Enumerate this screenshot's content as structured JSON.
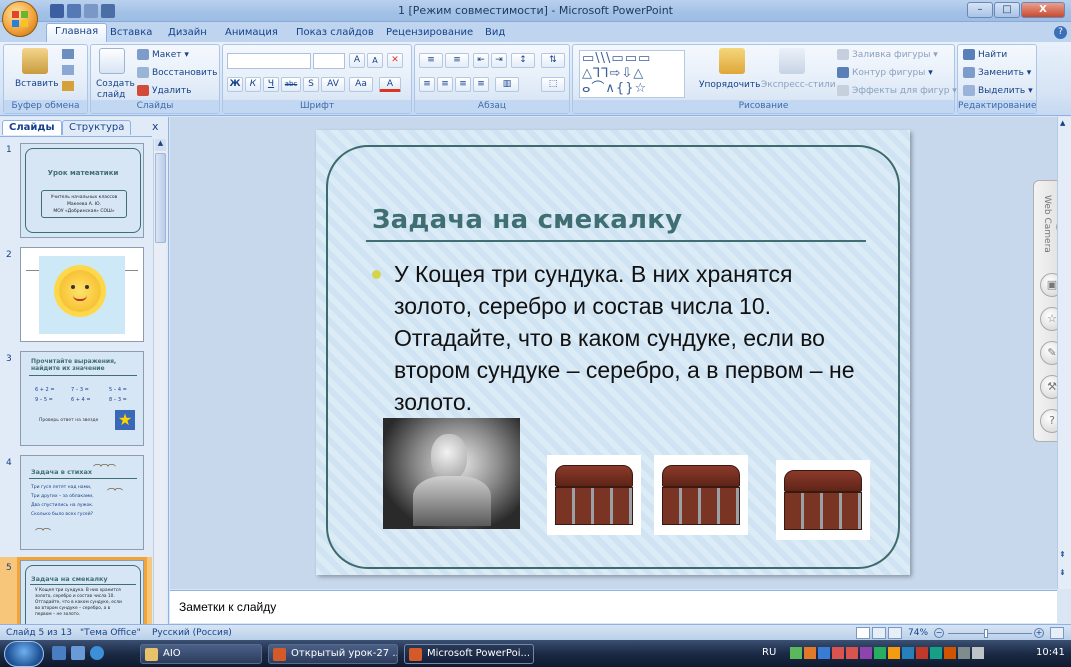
{
  "window": {
    "title": "1 [Режим совместимости] - Microsoft PowerPoint",
    "controls": [
      "–",
      "□",
      "X"
    ]
  },
  "ribbon_tabs": [
    "Главная",
    "Вставка",
    "Дизайн",
    "Анимация",
    "Показ слайдов",
    "Рецензирование",
    "Вид"
  ],
  "ribbon": {
    "clipboard": {
      "paste": "Вставить",
      "label": "Буфер обмена"
    },
    "slides": {
      "create": "Создать",
      "create2": "слайд",
      "layout": "Макет",
      "restore": "Восстановить",
      "delete": "Удалить",
      "label": "Слайды"
    },
    "font": {
      "label": "Шрифт",
      "grow": "A",
      "shrink": "A",
      "bold": "Ж",
      "italic": "К",
      "underline": "Ч",
      "strike": "abc",
      "shadow": "S",
      "spacing": "AV",
      "case": "Aa",
      "color": "A"
    },
    "paragraph": {
      "label": "Абзац"
    },
    "drawing": {
      "arrange": "Упорядочить",
      "styles": "Экспресс-стили",
      "fill": "Заливка фигуры",
      "outline": "Контур фигуры",
      "effects": "Эффекты для фигур",
      "label": "Рисование"
    },
    "editing": {
      "find": "Найти",
      "replace": "Заменить",
      "select": "Выделить",
      "label": "Редактирование"
    }
  },
  "panel": {
    "tab_slides": "Слайды",
    "tab_outline": "Структура",
    "close": "x",
    "thumbs": [
      {
        "num": "1",
        "title": "Урок математики",
        "lines": [
          "Учитель начальных классов",
          "Макеева А. Ю.",
          "МОУ «Добринская» СОШ»"
        ]
      },
      {
        "num": "2"
      },
      {
        "num": "3",
        "title": "Прочитайте выражения, найдите их значение",
        "lines": [
          "6 + 2 =",
          "7 – 3 =",
          "5 – 4 =",
          "9 – 5 =",
          "6 + 4 =",
          "8 – 3 =",
          "Проверь ответ на звезде"
        ]
      },
      {
        "num": "4",
        "title": "Задача в стихах",
        "lines": [
          "Три гуся летят над нами,",
          "Три других – за облаками,",
          "Два спустились на лужок.",
          "Сколько было всех гусей?"
        ]
      },
      {
        "num": "5",
        "title": "Задача на смекалку",
        "lines": [
          "У Кощея три сундука. В них хранится",
          "золото, серебро и состав числа 10.",
          "Отгадайте, что в каком сундуке, если",
          "во втором сундуке – серебро, а в",
          "первом – не золото."
        ]
      }
    ]
  },
  "slide": {
    "title": "Задача на смекалку",
    "body": "У Кощея три сундука. В них хранятся золото, серебро и состав числа 10. Отгадайте, что в каком сундуке, если во втором сундуке – серебро, а в первом – не золото."
  },
  "webcam": {
    "label": "Web Camera"
  },
  "notes": {
    "placeholder": "Заметки к слайду"
  },
  "status": {
    "slide": "Слайд 5 из 13",
    "theme": "\"Тема Office\"",
    "lang": "Русский (Россия)",
    "zoom": "74%"
  },
  "taskbar": {
    "items": [
      "AIO",
      "Открытый урок-27 ...",
      "Microsoft PowerPoi..."
    ],
    "lang": "RU",
    "clock": "10:41"
  },
  "colors": {
    "accent": "#3f6f72",
    "ribbon": "#dbe6f4",
    "selection": "#f0a43a"
  }
}
